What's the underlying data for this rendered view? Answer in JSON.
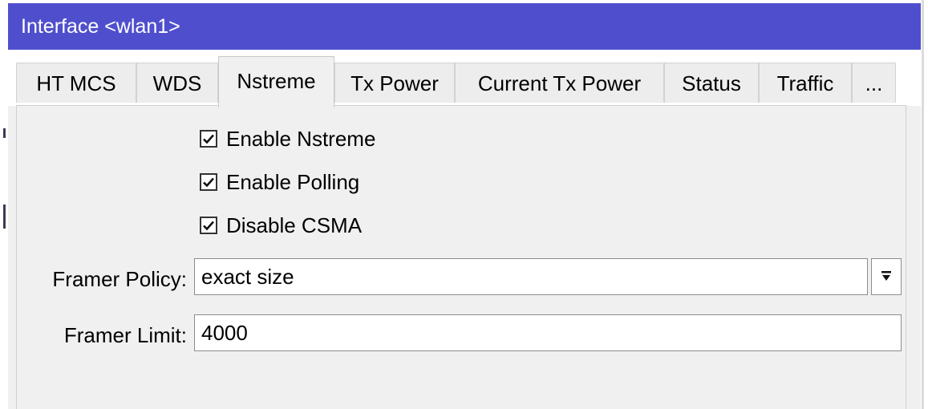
{
  "window": {
    "title": "Interface <wlan1>"
  },
  "tabs": [
    {
      "label": "HT MCS",
      "active": false
    },
    {
      "label": "WDS",
      "active": false
    },
    {
      "label": "Nstreme",
      "active": true
    },
    {
      "label": "Tx Power",
      "active": false
    },
    {
      "label": "Current Tx Power",
      "active": false
    },
    {
      "label": "Status",
      "active": false
    },
    {
      "label": "Traffic",
      "active": false
    },
    {
      "label": "...",
      "active": false
    }
  ],
  "options": {
    "enable_nstreme": {
      "label": "Enable Nstreme",
      "checked": true
    },
    "enable_polling": {
      "label": "Enable Polling",
      "checked": true
    },
    "disable_csma": {
      "label": "Disable CSMA",
      "checked": true
    }
  },
  "framer_policy": {
    "label": "Framer Policy:",
    "value": "exact size"
  },
  "framer_limit": {
    "label": "Framer Limit:",
    "value": "4000"
  },
  "colors": {
    "titlebar": "#4f4fce",
    "panel_bg": "#f0f0f0",
    "tab_bg": "#ededed"
  },
  "icons": {
    "checkbox_mark": "checkmark-icon",
    "dropdown": "dropdown-arrow-icon"
  }
}
